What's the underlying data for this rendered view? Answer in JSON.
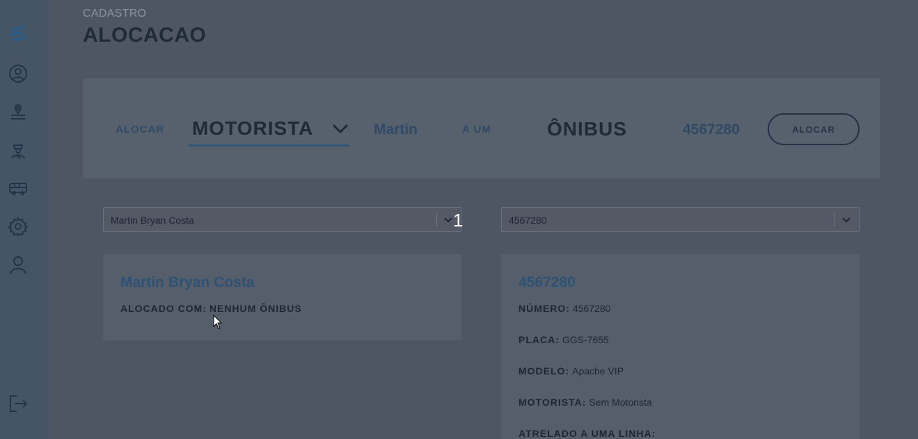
{
  "header": {
    "subtitle": "CADASTRO",
    "title": "ALOCACAO"
  },
  "sidebar": {
    "items": [
      {
        "icon": "logo-icon"
      },
      {
        "icon": "user-circle-icon"
      },
      {
        "icon": "route-icon"
      },
      {
        "icon": "driver-icon"
      },
      {
        "icon": "bus-icon"
      },
      {
        "icon": "gear-icon"
      },
      {
        "icon": "person-icon"
      },
      {
        "icon": "logout-icon"
      }
    ]
  },
  "alloc_bar": {
    "alocar_text": "ALOCAR",
    "type_select": "MOTORISTA",
    "selected_name": "Martin",
    "a_um_text": "A UM",
    "target_type": "ÔNIBUS",
    "target_value": "4567280",
    "button_label": "ALOCAR"
  },
  "selects": {
    "left": {
      "value": "Martin Bryan Costa"
    },
    "right": {
      "value": "4567280"
    },
    "badge": "1"
  },
  "driver_card": {
    "name": "Martin Bryan Costa",
    "alocado_label": "ALOCADO COM:",
    "alocado_value": "NENHUM ÔNIBUS"
  },
  "bus_card": {
    "title": "4567280",
    "rows": [
      {
        "label": "NÚMERO:",
        "value": "4567280"
      },
      {
        "label": "PLACA:",
        "value": "GGS-7655"
      },
      {
        "label": "MODELO:",
        "value": "Apache VIP"
      },
      {
        "label": "MOTORISTA:",
        "value": "Sem Motorista"
      },
      {
        "label": "ATRELADO A UMA LINHA:",
        "value": ""
      }
    ]
  },
  "colors": {
    "background": "#4f5663",
    "sidebar": "#465566",
    "accent": "#2d5274"
  }
}
